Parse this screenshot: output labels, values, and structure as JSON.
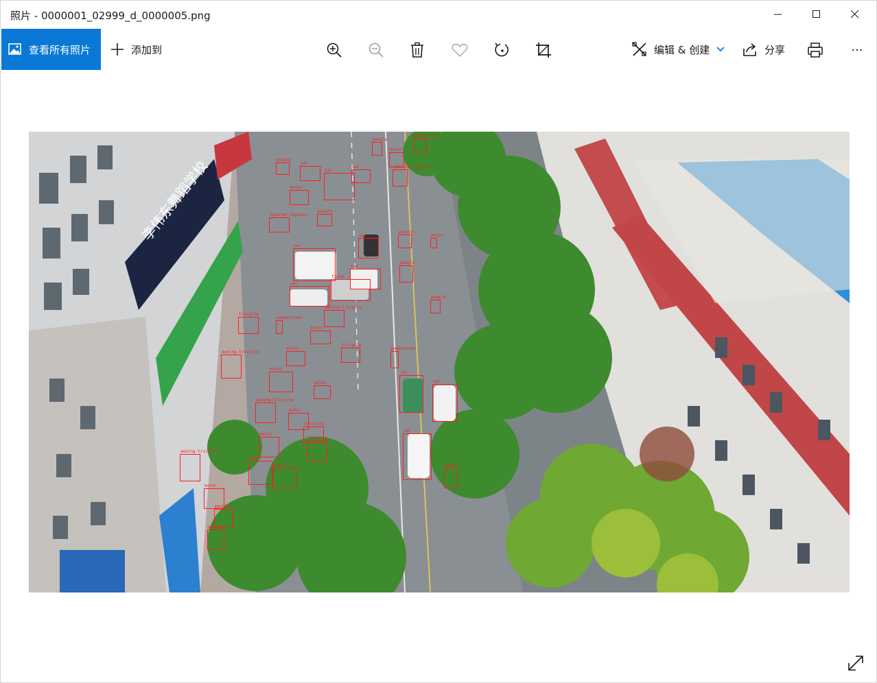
{
  "window": {
    "title": "照片 - 0000001_02999_d_0000005.png"
  },
  "toolbar": {
    "view_all_label": "查看所有照片",
    "add_to_label": "添加到",
    "edit_create_label": "编辑 & 创建",
    "share_label": "分享",
    "more_label": "···",
    "icons": [
      "zoom-in-icon",
      "zoom-out-icon",
      "delete-icon",
      "favorite-icon",
      "rotate-icon",
      "crop-icon",
      "print-icon"
    ]
  },
  "colors": {
    "accent": "#0a78d7",
    "detection_box": "#ff1e1e"
  },
  "photo": {
    "shop_sign": "李伟东舞蹈学校",
    "detection_labels": [
      "car",
      "pedestrian",
      "people",
      "motor",
      "tricycle",
      "awning-tricycle",
      "van",
      "truck",
      "bicycle",
      "ignored regions"
    ]
  }
}
